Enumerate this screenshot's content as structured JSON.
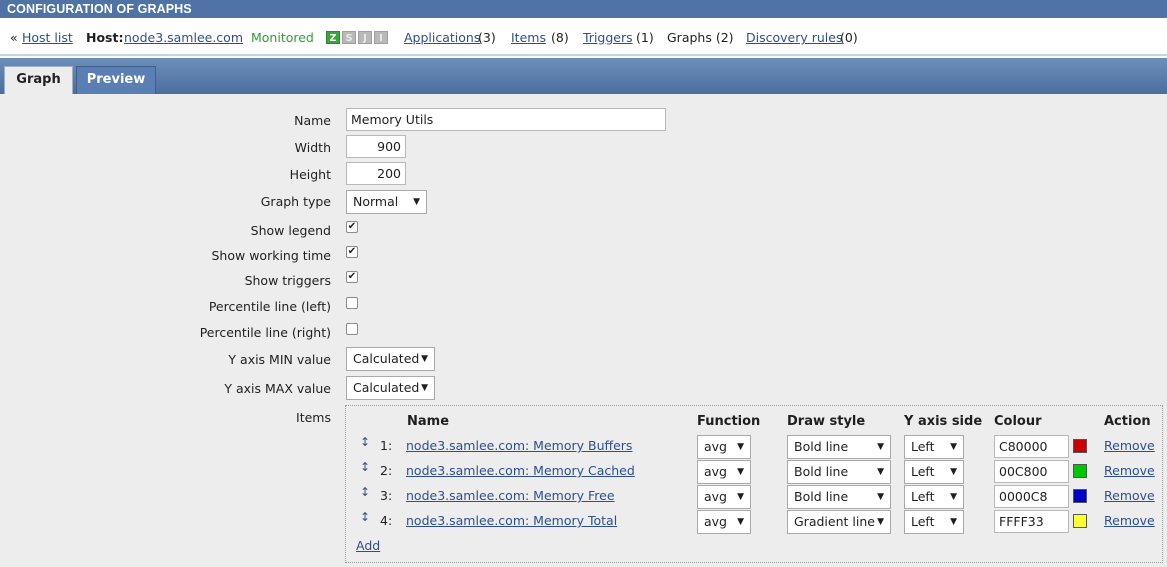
{
  "page_title": "CONFIGURATION OF GRAPHS",
  "hostbar": {
    "back_symbol": "«",
    "host_list": "Host list",
    "host_label": "Host:",
    "host_name": "node3.samlee.com",
    "status": "Monitored",
    "availability": [
      "Z",
      "S",
      "J",
      "I"
    ],
    "applications": "Applications",
    "applications_count": "(3)",
    "items": "Items",
    "items_count": "(8)",
    "triggers": "Triggers",
    "triggers_count": "(1)",
    "graphs": "Graphs (2)",
    "discovery": "Discovery rules",
    "discovery_count": "(0)"
  },
  "tabs": [
    {
      "label": "Graph",
      "active": true
    },
    {
      "label": "Preview",
      "active": false
    }
  ],
  "form": {
    "name_label": "Name",
    "name_value": "Memory Utils",
    "width_label": "Width",
    "width_value": "900",
    "height_label": "Height",
    "height_value": "200",
    "graph_type_label": "Graph type",
    "graph_type_value": "Normal",
    "show_legend_label": "Show legend",
    "show_working_time_label": "Show working time",
    "show_triggers_label": "Show triggers",
    "percentile_left_label": "Percentile line (left)",
    "percentile_right_label": "Percentile line (right)",
    "ymin_label": "Y axis MIN value",
    "ymin_value": "Calculated",
    "ymax_label": "Y axis MAX value",
    "ymax_value": "Calculated",
    "items_label": "Items",
    "checkmark": "✔"
  },
  "items_table": {
    "headers": {
      "name": "Name",
      "function": "Function",
      "draw_style": "Draw style",
      "y_axis_side": "Y axis side",
      "colour": "Colour",
      "action": "Action"
    },
    "move_icon": "↕",
    "rows": [
      {
        "num": "1:",
        "name": "node3.samlee.com: Memory Buffers",
        "function": "avg",
        "draw_style": "Bold line",
        "y_axis_side": "Left",
        "colour": "C80000",
        "swatch": "#C80000",
        "action": "Remove"
      },
      {
        "num": "2:",
        "name": "node3.samlee.com: Memory Cached",
        "function": "avg",
        "draw_style": "Bold line",
        "y_axis_side": "Left",
        "colour": "00C800",
        "swatch": "#00C800",
        "action": "Remove"
      },
      {
        "num": "3:",
        "name": "node3.samlee.com: Memory Free",
        "function": "avg",
        "draw_style": "Bold line",
        "y_axis_side": "Left",
        "colour": "0000C8",
        "swatch": "#0000C8",
        "action": "Remove"
      },
      {
        "num": "4:",
        "name": "node3.samlee.com: Memory Total",
        "function": "avg",
        "draw_style": "Gradient line",
        "y_axis_side": "Left",
        "colour": "FFFF33",
        "swatch": "#FFFF33",
        "action": "Remove"
      }
    ],
    "add_label": "Add"
  },
  "colors": {
    "titlebar": "#4f73a4",
    "link": "#2d4f8f",
    "monitored": "#2ea02e",
    "panel": "#ededed"
  },
  "icons": {
    "dropdown_arrow": "▼"
  }
}
